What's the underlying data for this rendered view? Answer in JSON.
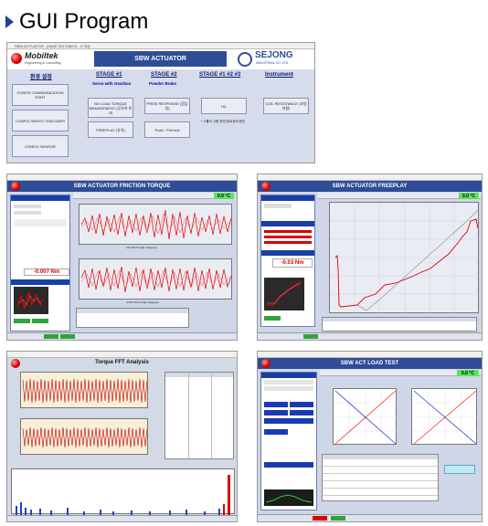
{
  "heading": {
    "title": "GUI Program"
  },
  "launcher": {
    "titlebar": "SBW ACTUATOR - [SAVE 2017/08/09 - 17:53]",
    "brand": "Mobiltek",
    "brand_sub": "Engineering & Consulting",
    "banner": "SBW ACTUATOR",
    "company": "SEJONG",
    "company_sub": "INDUSTRIAL CO.,LTD.",
    "col_basic": "환경 설정",
    "col_stage1": "STAGE #1",
    "col_stage2": "STAGE #2",
    "col_stage123": "STAGE #1 #2 #3",
    "col_instrument": "Instrument",
    "stage1_sub": "Servo with Gearbox",
    "stage2_sub": "Powder Brake",
    "btn_comm": "CONFIG COMMUNICATION PORT",
    "btn_servo": "CONFIG SERVO / ENCODER",
    "btn_sensor": "CONFIG SENSOR",
    "btn_noload": "NO LOAD TORQUE MANAGEMENT (무부하 토크)",
    "btn_freeplay": "FREEPLAY (유격)",
    "btn_fft": "PRISE RESPONSE (응답성)",
    "btn_push_pull": "Push - Pull test",
    "btn_hil": "H/L",
    "btn_coil": "COIL RESISTANCE (코일저항)",
    "note": "* 스톨이 시험 준비 완료상태 확인"
  },
  "friction": {
    "title": "SBW ACTUATOR FRICTION TORQUE",
    "torque_value": "-0.007 Nm",
    "temp_value": "0.0 °C",
    "x_label1": "CW Pitch Angle (Degree)",
    "x_label2": "CCW Pitch Angle (Degree)"
  },
  "freeplay": {
    "title": "SBW ACTUATOR FREEPLAY",
    "angle_value": "-0.03 Nm",
    "temp_value": "0.0 °C"
  },
  "fft": {
    "title": "Torque FFT Analysis"
  },
  "actload": {
    "title": "SBW ACT LOAD TEST",
    "temp_value": "0.0 °C"
  },
  "colors": {
    "blue_bar": "#2f4c97",
    "signal_red": "#e00000",
    "lcd_green": "#5ee25e"
  }
}
